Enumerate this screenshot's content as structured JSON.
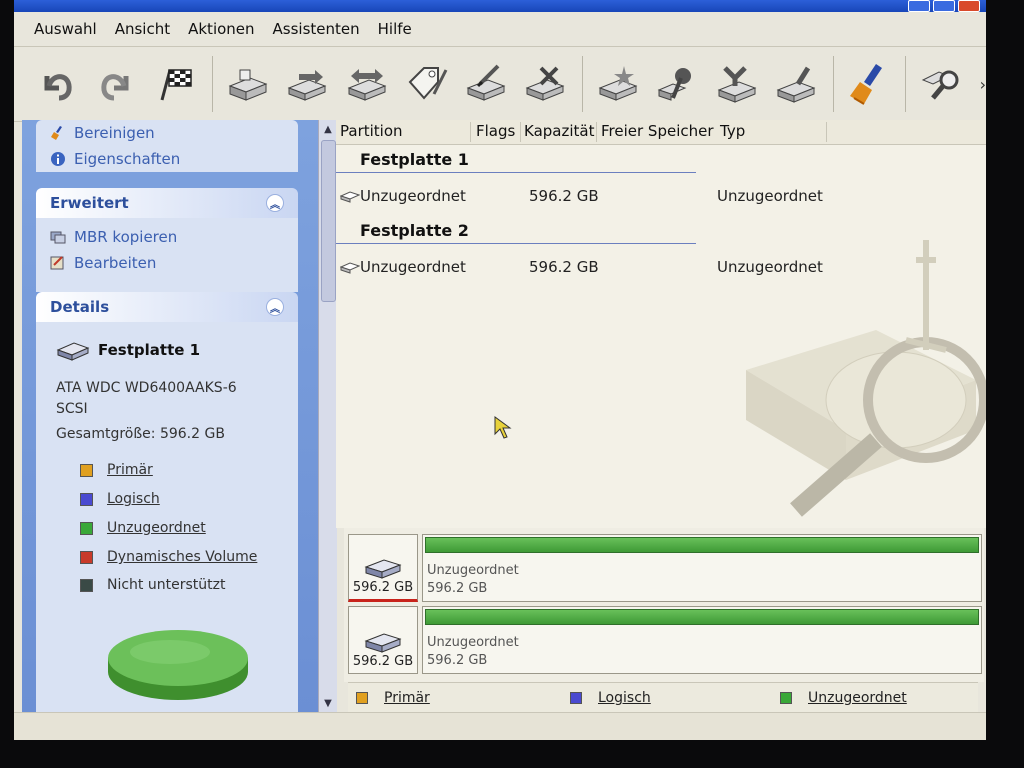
{
  "window": {
    "title": ""
  },
  "menu": [
    {
      "label": "Auswahl"
    },
    {
      "label": "Ansicht"
    },
    {
      "label": "Aktionen"
    },
    {
      "label": "Assistenten"
    },
    {
      "label": "Hilfe"
    }
  ],
  "toolbar": {
    "icons": [
      "undo-icon",
      "redo-icon",
      "apply-icon",
      "create-partition-icon",
      "move-partition-icon",
      "resize-partition-icon",
      "label-partition-icon",
      "format-partition-icon",
      "delete-partition-icon",
      "new-disk-icon",
      "properties-icon",
      "merge-icon",
      "wipe-icon",
      "cleanup-icon",
      "search-icon"
    ],
    "more": "›"
  },
  "sidebar": {
    "tasks_top": [
      {
        "label": "Bereinigen",
        "icon": "cleanup-icon"
      },
      {
        "label": "Eigenschaften",
        "icon": "info-icon"
      }
    ],
    "advanced": {
      "title": "Erweitert",
      "items": [
        {
          "label": "MBR kopieren",
          "icon": "copy-mbr-icon"
        },
        {
          "label": "Bearbeiten",
          "icon": "edit-icon"
        }
      ]
    },
    "details": {
      "title": "Details",
      "disk_name": "Festplatte 1",
      "model": "ATA WDC WD6400AAKS-6",
      "bus": "SCSI",
      "total_size": "Gesamtgröße: 596.2 GB",
      "legend": [
        {
          "label": "Primär",
          "color": "#e0a020"
        },
        {
          "label": "Logisch",
          "color": "#4a4ad0"
        },
        {
          "label": "Unzugeordnet",
          "color": "#3aa838"
        },
        {
          "label": "Dynamisches Volume",
          "color": "#c83a2a"
        },
        {
          "label": "Nicht unterstützt",
          "color": "#3a4a46"
        }
      ]
    }
  },
  "list": {
    "columns": [
      "Partition",
      "Flags",
      "Kapazität",
      "Freier Speicher",
      "Typ"
    ],
    "groups": [
      {
        "name": "Festplatte 1",
        "rows": [
          {
            "partition": "Unzugeordnet",
            "capacity": "596.2 GB",
            "type": "Unzugeordnet"
          }
        ]
      },
      {
        "name": "Festplatte 2",
        "rows": [
          {
            "partition": "Unzugeordnet",
            "capacity": "596.2 GB",
            "type": "Unzugeordnet"
          }
        ]
      }
    ]
  },
  "diskmap": [
    {
      "size": "596.2 GB",
      "part_name": "Unzugeordnet",
      "part_size": "596.2 GB",
      "selected": true
    },
    {
      "size": "596.2 GB",
      "part_name": "Unzugeordnet",
      "part_size": "596.2 GB",
      "selected": false
    }
  ],
  "bottom_legend": [
    {
      "label": "Primär",
      "color": "#e0a020"
    },
    {
      "label": "Logisch",
      "color": "#4a4ad0"
    },
    {
      "label": "Unzugeordnet",
      "color": "#3aa838"
    }
  ]
}
